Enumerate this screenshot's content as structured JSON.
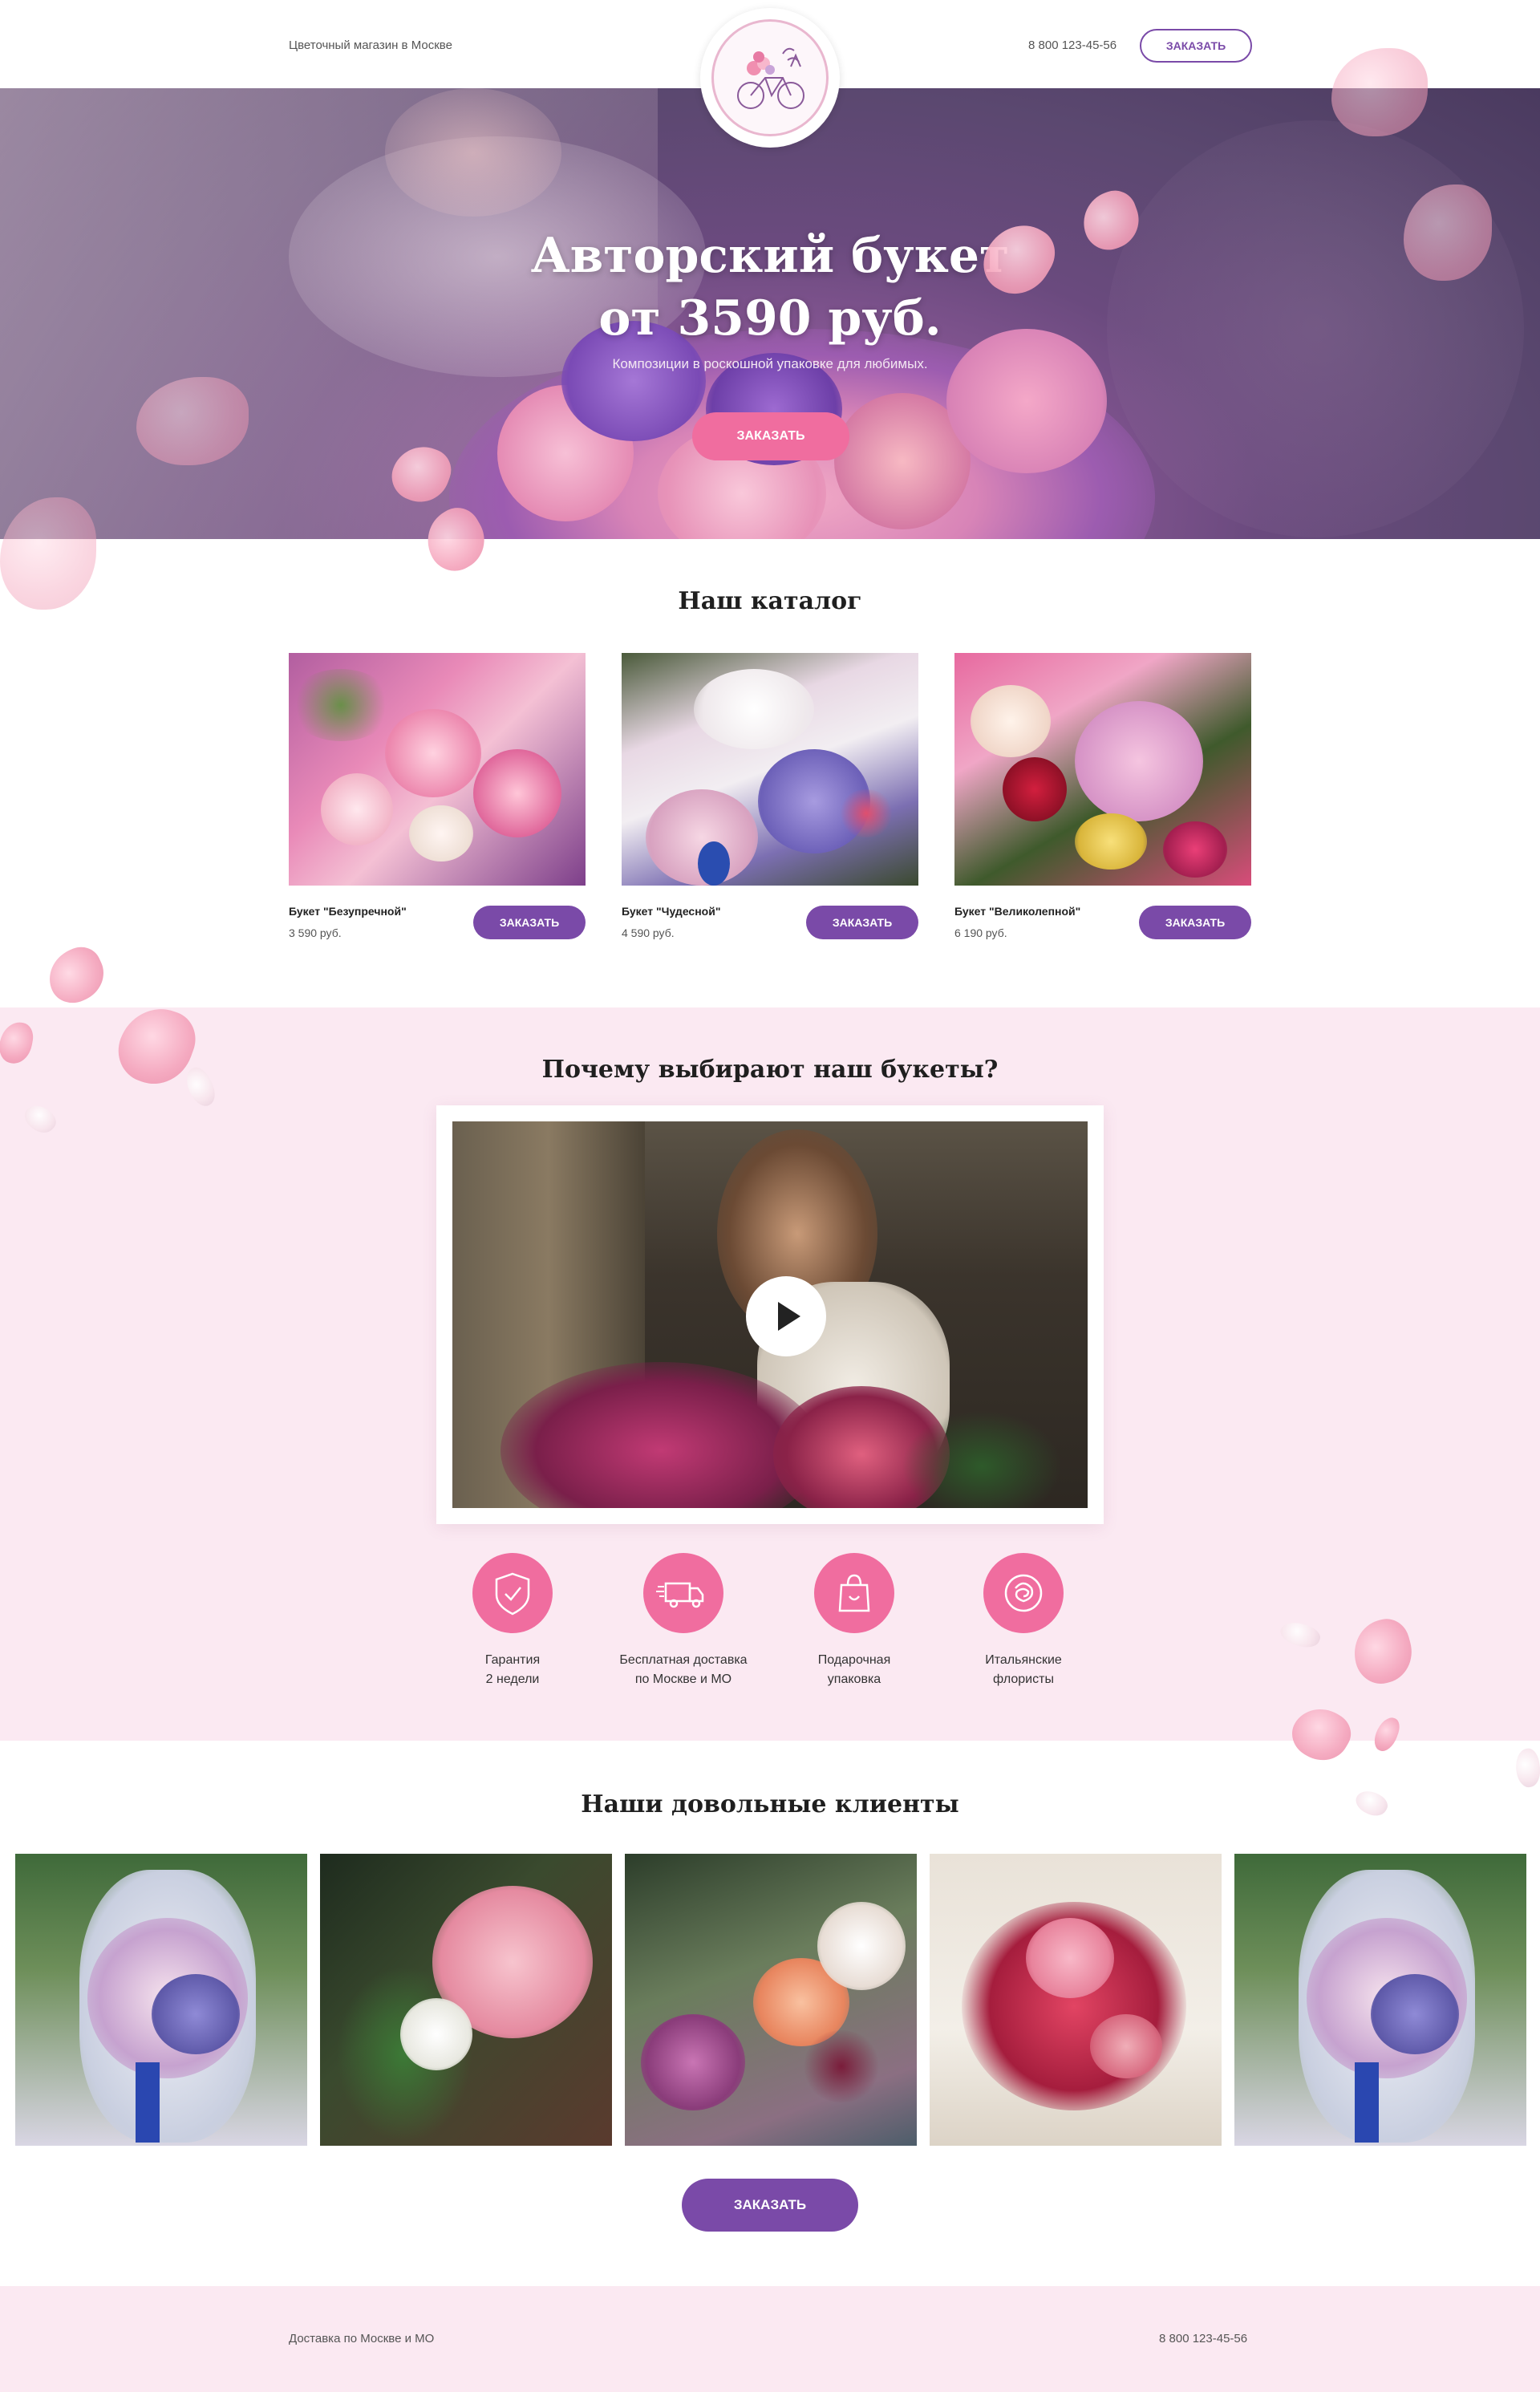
{
  "header": {
    "tagline": "Цветочный магазин в Москве",
    "phone": "8 800 123-45-56",
    "order_button": "ЗАКАЗАТЬ",
    "logo_icon": "bicycle-flowers-logo"
  },
  "hero": {
    "title_line1": "Авторский букет",
    "title_line2": "от 3590 руб.",
    "subtitle": "Композиции в роскошной упаковке для любимых.",
    "order_button": "ЗАКАЗАТЬ"
  },
  "catalog": {
    "title": "Наш каталог",
    "items": [
      {
        "name": "Букет \"Безупречной\"",
        "price": "3 590 руб.",
        "button": "ЗАКАЗАТЬ"
      },
      {
        "name": "Букет \"Чудесной\"",
        "price": "4 590 руб.",
        "button": "ЗАКАЗАТЬ"
      },
      {
        "name": "Букет \"Великолепной\"",
        "price": "6 190 руб.",
        "button": "ЗАКАЗАТЬ"
      }
    ]
  },
  "why": {
    "title": "Почему выбирают наш  букеты?",
    "video_icon": "play-icon",
    "features": [
      {
        "line1": "Гарантия",
        "line2": "2 недели",
        "icon": "shield-check-icon"
      },
      {
        "line1": "Бесплатная доставка",
        "line2": "по Москве и МО",
        "icon": "delivery-truck-icon"
      },
      {
        "line1": "Подарочная",
        "line2": "упаковка",
        "icon": "gift-bag-icon"
      },
      {
        "line1": "Итальянские",
        "line2": "флористы",
        "icon": "rose-icon"
      }
    ]
  },
  "clients": {
    "title": "Наши довольные клиенты",
    "order_button": "ЗАКАЗАТЬ"
  },
  "footer": {
    "delivery": "Доставка по Москве и МО",
    "phone": "8 800 123-45-56"
  },
  "colors": {
    "accent_purple": "#7a4aa8",
    "accent_pink": "#f06d9f",
    "section_pink": "#fbe9f2"
  }
}
